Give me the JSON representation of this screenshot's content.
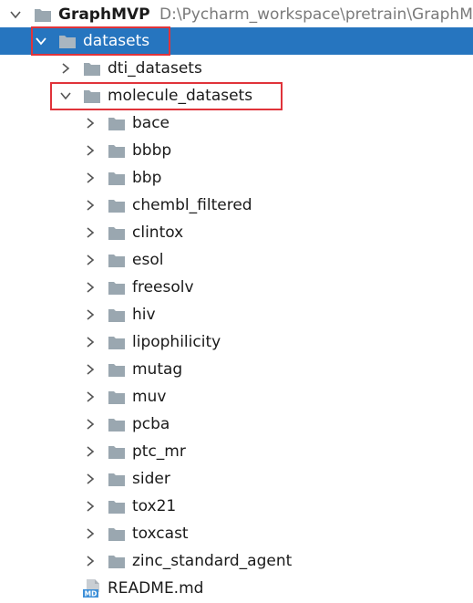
{
  "project": {
    "name": "GraphMVP",
    "path": "D:\\Pycharm_workspace\\pretrain\\GraphMVP"
  },
  "tree": {
    "datasets": "datasets",
    "dti_datasets": "dti_datasets",
    "molecule_datasets": "molecule_datasets",
    "molecule_children": [
      "bace",
      "bbbp",
      "bbp",
      "chembl_filtered",
      "clintox",
      "esol",
      "freesolv",
      "hiv",
      "lipophilicity",
      "mutag",
      "muv",
      "pcba",
      "ptc_mr",
      "sider",
      "tox21",
      "toxcast",
      "zinc_standard_agent"
    ],
    "readme": "README.md",
    "readme_badge": "MD"
  },
  "colors": {
    "selection": "#2675bf",
    "highlight_box": "#e0333a",
    "folder": "#9aa7b0",
    "readme_badge": "#3d8fd8"
  },
  "icons": {
    "folder": "folder-icon",
    "chevron_right": "chevron-right-icon",
    "chevron_down": "chevron-down-icon",
    "markdown": "markdown-file-icon"
  }
}
